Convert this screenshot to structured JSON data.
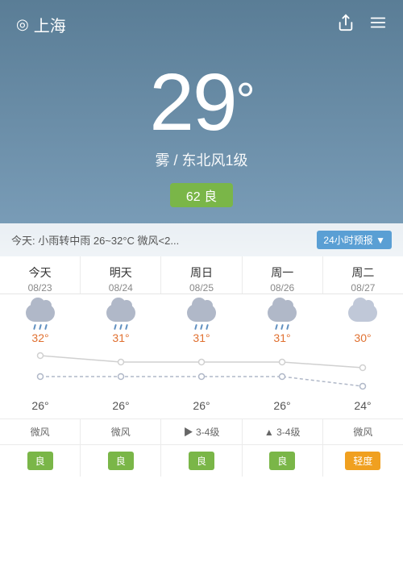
{
  "header": {
    "location": "上海",
    "share_icon": "⇡",
    "menu_icon": "☰"
  },
  "current": {
    "temperature": "29",
    "degree_symbol": "°",
    "weather": "雾 / 东北风1级",
    "aqi_value": "62",
    "aqi_label": "良"
  },
  "today_bar": {
    "text": "今天: 小雨转中雨  26~32°C  微风<2...",
    "btn_label": "24小时预报",
    "btn_arrow": "▼"
  },
  "forecast": {
    "columns": [
      {
        "day": "今天",
        "date": "08/23",
        "icon": "rain",
        "high": "32°",
        "low": "26°",
        "wind": "微风",
        "aqi": "良",
        "aqi_class": ""
      },
      {
        "day": "明天",
        "date": "08/24",
        "icon": "rain",
        "high": "31°",
        "low": "26°",
        "wind": "微风",
        "aqi": "良",
        "aqi_class": ""
      },
      {
        "day": "周日",
        "date": "08/25",
        "icon": "rain",
        "high": "31°",
        "low": "26°",
        "wind": "▶ 3-4级",
        "aqi": "良",
        "aqi_class": ""
      },
      {
        "day": "周一",
        "date": "08/26",
        "icon": "rain",
        "high": "31°",
        "low": "26°",
        "wind": "▲ 3-4级",
        "aqi": "良",
        "aqi_class": ""
      },
      {
        "day": "周二",
        "date": "08/27",
        "icon": "cloud",
        "high": "30°",
        "low": "24°",
        "wind": "微风",
        "aqi": "轻度",
        "aqi_class": "moderate"
      }
    ],
    "chart": {
      "high_points": [
        50,
        62,
        62,
        62,
        68
      ],
      "low_points": [
        82,
        82,
        82,
        82,
        92
      ]
    }
  }
}
